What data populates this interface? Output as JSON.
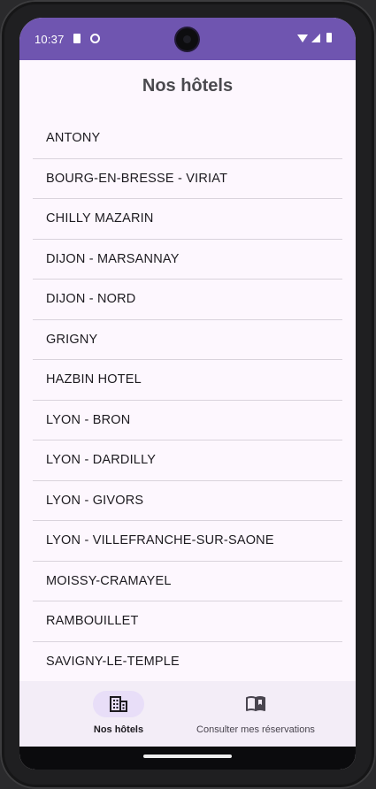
{
  "status_bar": {
    "time": "10:37",
    "background_color": "#6f55b0",
    "icons": [
      "sim-card-icon",
      "sync-icon",
      "wifi-icon",
      "cell-signal-icon",
      "battery-icon"
    ]
  },
  "header": {
    "title": "Nos hôtels"
  },
  "hotels": [
    {
      "name": "ANTONY"
    },
    {
      "name": "BOURG-EN-BRESSE - VIRIAT"
    },
    {
      "name": "CHILLY MAZARIN"
    },
    {
      "name": "DIJON - MARSANNAY"
    },
    {
      "name": "DIJON - NORD"
    },
    {
      "name": "GRIGNY"
    },
    {
      "name": "HAZBIN HOTEL"
    },
    {
      "name": "LYON - BRON"
    },
    {
      "name": "LYON - DARDILLY"
    },
    {
      "name": "LYON - GIVORS"
    },
    {
      "name": "LYON - VILLEFRANCHE-SUR-SAONE"
    },
    {
      "name": "MOISSY-CRAMAYEL"
    },
    {
      "name": "RAMBOUILLET"
    },
    {
      "name": "SAVIGNY-LE-TEMPLE"
    }
  ],
  "bottom_nav": {
    "items": [
      {
        "label": "Nos hôtels",
        "icon": "hotel-building-icon",
        "selected": true
      },
      {
        "label": "Consulter mes réservations",
        "icon": "open-book-icon",
        "selected": false
      }
    ],
    "active_indicator_color": "#e8def8"
  }
}
